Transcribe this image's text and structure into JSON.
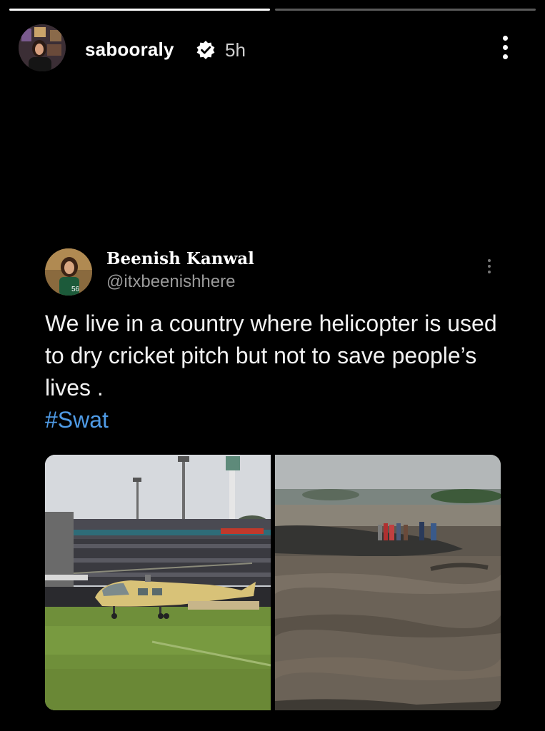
{
  "story": {
    "progress": [
      1.0,
      0.0
    ]
  },
  "header": {
    "username": "sabooraly",
    "time": "5h",
    "avatar_icon": "profile-avatar",
    "verified_icon": "verified-badge-icon",
    "more_icon": "more-vertical-icon"
  },
  "tweet": {
    "display_name": "Beenish Kanwal",
    "handle": "@itxbeenishhere",
    "text": "We live in a country where helicopter is used to dry cricket pitch but not to save people’s lives .",
    "hashtag": "#Swat",
    "more_icon": "more-vertical-icon"
  },
  "colors": {
    "background": "#000000",
    "hashtag": "#4f9be6",
    "handle": "#9a9a9a"
  }
}
